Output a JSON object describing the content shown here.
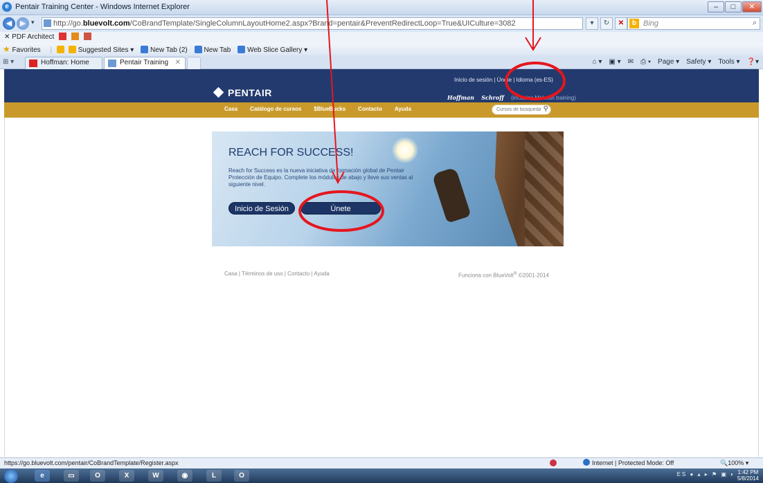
{
  "browser": {
    "window_title": "Pentair Training Center - Windows Internet Explorer",
    "url_prefix": "http://go.",
    "url_domain": "bluevolt.com",
    "url_path": "/CoBrandTemplate/SingleColumnLayoutHome2.aspx?Brand=pentair&PreventRedirectLoop=True&UICulture=3082",
    "search_placeholder": "Bing",
    "pdf_toolbar_label": "PDF Architect",
    "favorites": {
      "label": "Favorites",
      "items": [
        {
          "label": "Suggested Sites ▾"
        },
        {
          "label": "New Tab (2)"
        },
        {
          "label": "New Tab"
        },
        {
          "label": "Web Slice Gallery ▾"
        }
      ]
    },
    "tabs": [
      {
        "label": "Hoffman: Home"
      },
      {
        "label": "Pentair Training Center"
      }
    ],
    "command_bar": {
      "page": "Page ▾",
      "safety": "Safety ▾",
      "tools": "Tools ▾",
      "help": "❓▾"
    }
  },
  "site": {
    "top_links": "Inicio de sesión | Únete | Idioma (es-ES)",
    "logo_text": "PENTAIR",
    "brands": {
      "hoffman": "Hoffman",
      "schroff": "Schroff",
      "includes": "(includes McLean training)"
    },
    "nav": [
      {
        "label": "Casa"
      },
      {
        "label": "Catálogo de cursos"
      },
      {
        "label": "$BlueBucks"
      },
      {
        "label": "Contacto"
      },
      {
        "label": "Ayuda"
      }
    ],
    "search_placeholder": "Cursos de búsqueda",
    "hero": {
      "headline": "REACH FOR SUCCESS!",
      "description": "Reach for Success es la nueva iniciativa de formación global de Pentair Protección de Equipo. Complete los módulos de abajo y lleve sus ventas al siguiente nivel.",
      "login_button": "Inicio de Sesión",
      "join_button": "Únete"
    },
    "footer_links": "Casa | Términos de uso | Contacto | Ayuda",
    "footer_powered": "Funciona con BlueVolt",
    "footer_reg": "®",
    "footer_copy": " ©2001-2014"
  },
  "status": {
    "url": "https://go.bluevolt.com/pentair/CoBrandTemplate/Register.aspx",
    "zone": "Internet | Protected Mode: Off",
    "zoom": "100%"
  },
  "taskbar": {
    "lang": "ES",
    "time": "1:42 PM",
    "date": "5/8/2014"
  },
  "annotations": {
    "color": "#e5161d"
  }
}
